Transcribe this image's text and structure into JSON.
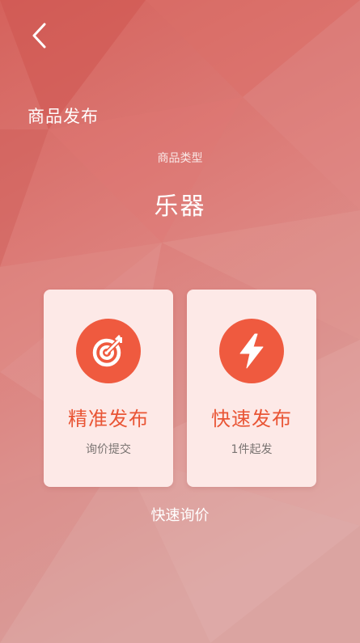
{
  "header": {
    "title": "商品发布"
  },
  "product_type": {
    "label": "商品类型",
    "value": "乐器"
  },
  "cards": [
    {
      "title": "精准发布",
      "subtitle": "询价提交",
      "icon": "target-icon"
    },
    {
      "title": "快速发布",
      "subtitle": "1件起发",
      "icon": "lightning-icon"
    }
  ],
  "footer": {
    "link_label": "快速询价"
  },
  "colors": {
    "background": "#d9726c",
    "card": "#fde9e7",
    "accent": "#ef5a3f",
    "card_title": "#e95535"
  }
}
